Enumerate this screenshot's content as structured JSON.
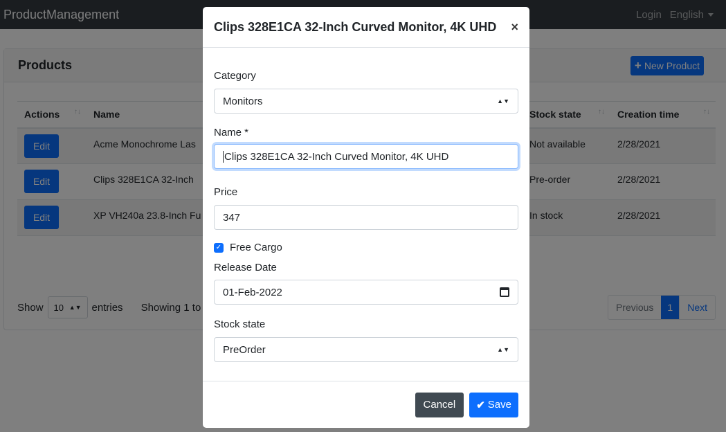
{
  "navbar": {
    "brand": "ProductManagement",
    "login": "Login",
    "language": "English"
  },
  "products_card": {
    "title": "Products",
    "new_button": "New Product",
    "columns": [
      "Actions",
      "Name",
      "Stock state",
      "Creation time"
    ],
    "rows": [
      {
        "action": "Edit",
        "name": "Acme Monochrome Las",
        "stock": "Not available",
        "created": "2/28/2021"
      },
      {
        "action": "Edit",
        "name": "Clips 328E1CA 32-Inch",
        "stock": "Pre-order",
        "created": "2/28/2021"
      },
      {
        "action": "Edit",
        "name": "XP VH240a 23.8-Inch Fu",
        "stock": "In stock",
        "created": "2/28/2021"
      }
    ],
    "show_label": "Show",
    "page_length": "10",
    "entries_label": "entries",
    "showing_text": "Showing 1 to",
    "pagination": {
      "previous": "Previous",
      "current": "1",
      "next": "Next"
    }
  },
  "modal": {
    "title": "Clips 328E1CA 32-Inch Curved Monitor, 4K UHD",
    "close": "×",
    "category_label": "Category",
    "category_value": "Monitors",
    "name_label": "Name *",
    "name_value": "Clips 328E1CA 32-Inch Curved Monitor, 4K UHD",
    "price_label": "Price",
    "price_value": "347",
    "free_cargo_label": "Free Cargo",
    "free_cargo_checked": true,
    "release_date_label": "Release Date",
    "release_date_value": "01-Feb-2022",
    "stock_state_label": "Stock state",
    "stock_state_value": "PreOrder",
    "cancel_label": "Cancel",
    "save_label": "Save"
  },
  "colors": {
    "primary": "#0d6efd",
    "navbar": "#343a40",
    "cancel": "#404a52"
  }
}
